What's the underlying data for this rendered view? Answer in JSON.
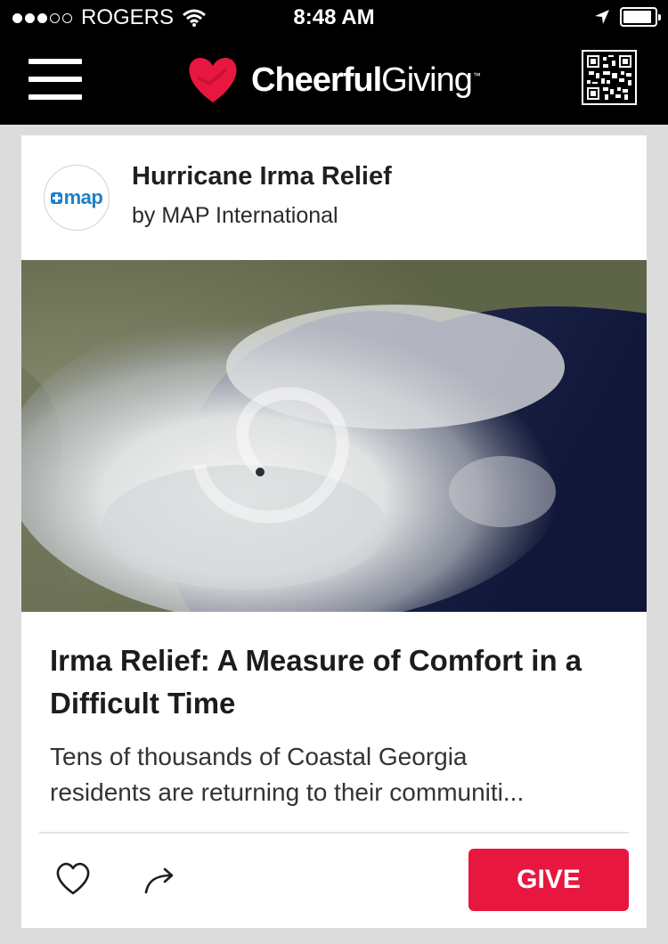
{
  "status_bar": {
    "carrier": "ROGERS",
    "signal_bars": 3,
    "signal_max": 5,
    "time": "8:48 AM",
    "battery_level": 0.9,
    "icons": [
      "wifi-icon",
      "location-arrow-icon",
      "battery-icon"
    ]
  },
  "navbar": {
    "brand_bold": "Cheerful",
    "brand_light": "Giving",
    "brand_tm": "™",
    "icons": [
      "hamburger-menu-icon",
      "heart-logo-icon",
      "qr-code-icon"
    ],
    "colors": {
      "background": "#000000",
      "logo_heart": "#e8173f"
    }
  },
  "card": {
    "campaign_title": "Hurricane Irma Relief",
    "organization_line": "by MAP International",
    "org_logo_text": "map",
    "hero_image": "satellite-hurricane-image",
    "story_title": "Irma Relief: A Measure of Comfort in a Difficult Time",
    "excerpt_lines": [
      "Tens of thousands of Coastal Georgia",
      "residents are returning to their communiti..."
    ],
    "actions": {
      "like_icon": "heart-outline-icon",
      "share_icon": "share-arrow-icon",
      "give_label": "GIVE"
    },
    "colors": {
      "give_button": "#e8173f",
      "logo_blue": "#1b82c8"
    }
  }
}
